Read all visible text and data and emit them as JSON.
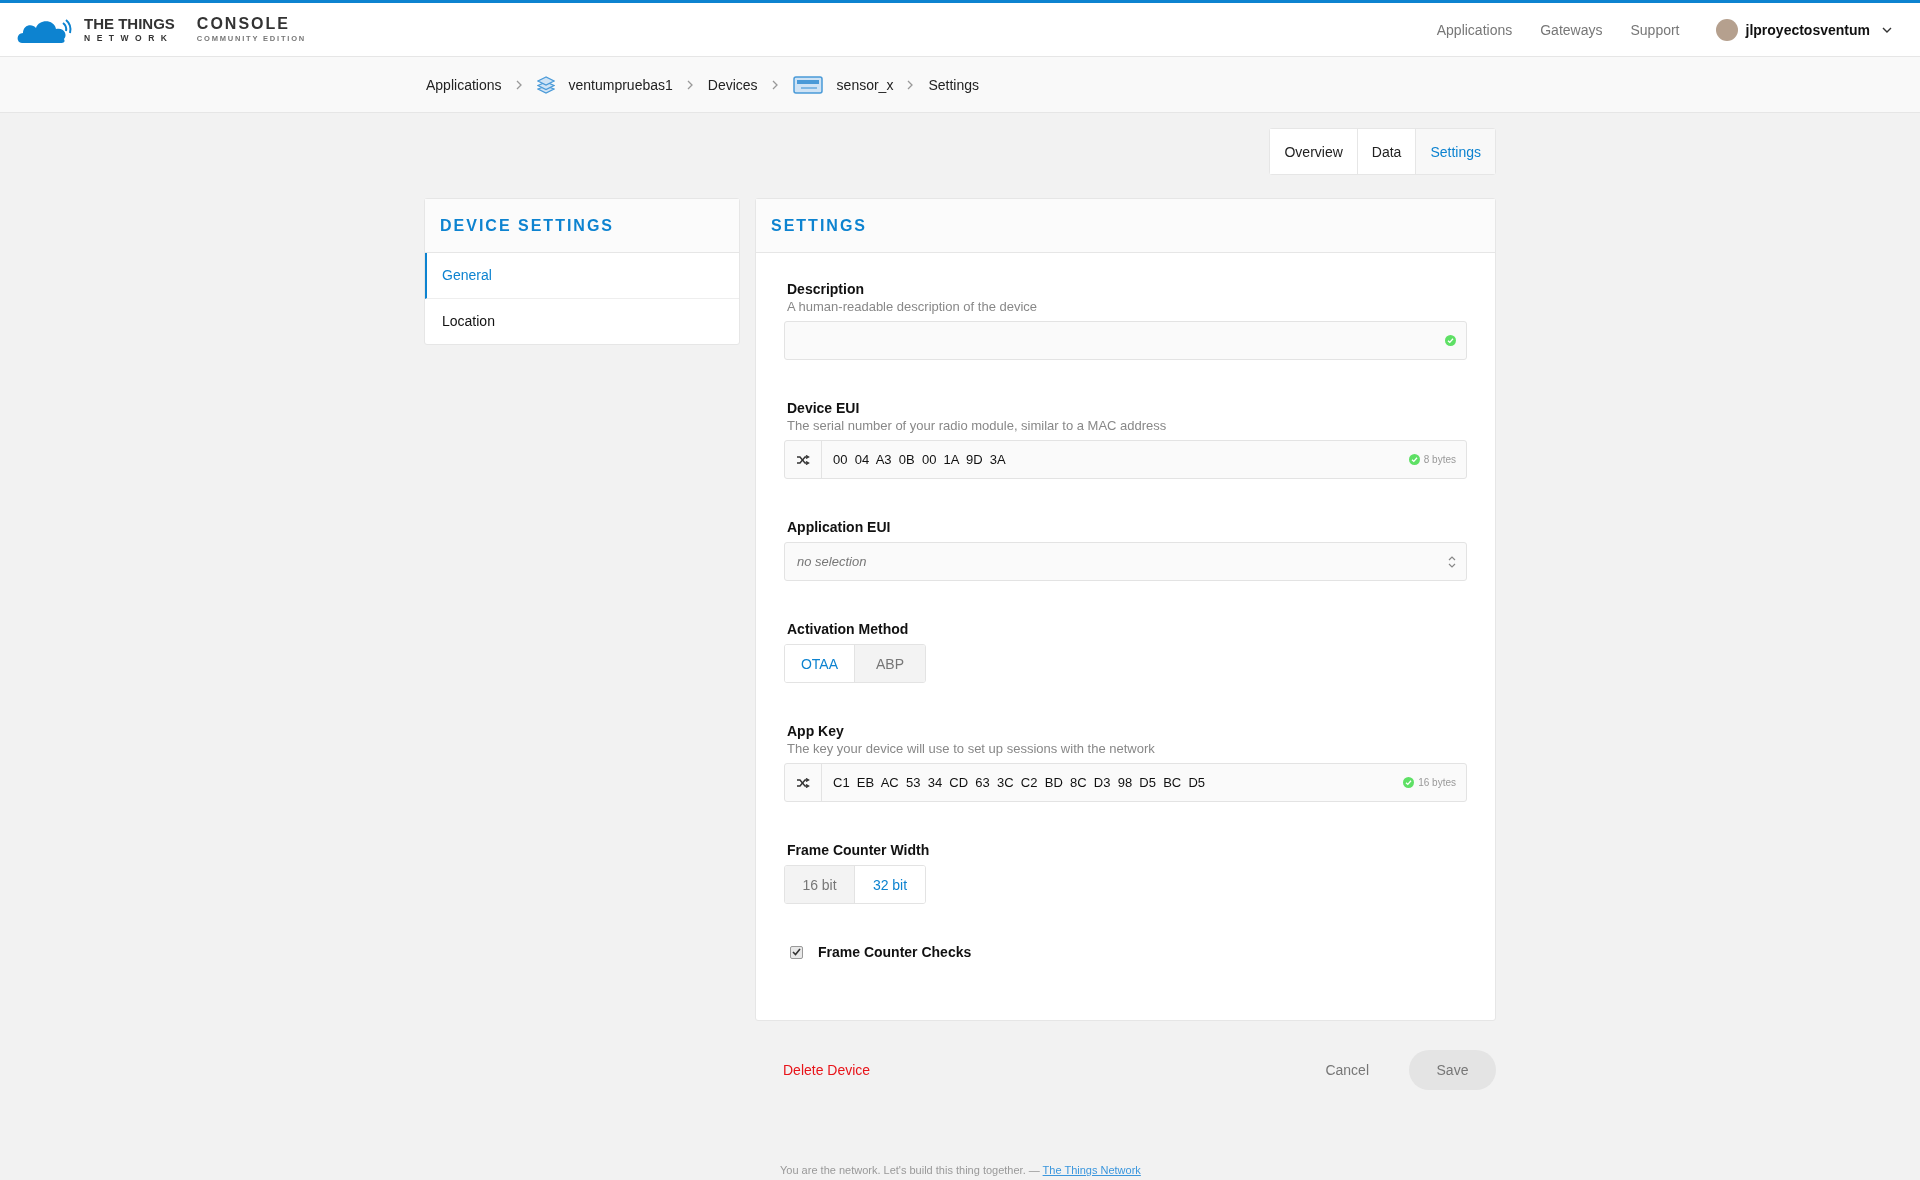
{
  "header": {
    "logo": {
      "line_1": "THE THINGS",
      "line_2": "NETWORK",
      "product": "CONSOLE",
      "edition": "COMMUNITY EDITION"
    },
    "nav": [
      "Applications",
      "Gateways",
      "Support"
    ],
    "user": {
      "name": "jlproyectosventum"
    }
  },
  "breadcrumb": [
    {
      "label": "Applications",
      "kind": "section"
    },
    {
      "label": "ventumpruebas1",
      "kind": "application"
    },
    {
      "label": "Devices",
      "kind": "section"
    },
    {
      "label": "sensor_x",
      "kind": "device"
    },
    {
      "label": "Settings",
      "kind": "section"
    }
  ],
  "tabs": [
    {
      "label": "Overview",
      "selected": false
    },
    {
      "label": "Data",
      "selected": false
    },
    {
      "label": "Settings",
      "selected": true
    }
  ],
  "sidebar": {
    "title": "DEVICE SETTINGS",
    "items": [
      {
        "label": "General",
        "selected": true
      },
      {
        "label": "Location",
        "selected": false
      }
    ]
  },
  "settings": {
    "title": "SETTINGS",
    "fields": [
      {
        "kind": "text",
        "label": "Description",
        "hint": "A human-readable description of the device",
        "valid": true
      },
      {
        "kind": "eui",
        "label": "Device EUI",
        "hint": "The serial number of your radio module, similar to a MAC address",
        "value": "00  04  A3  0B  00  1A  9D  3A",
        "size": "8 bytes",
        "valid": true
      },
      {
        "kind": "select",
        "label": "Application EUI",
        "placeholder": "no selection"
      },
      {
        "kind": "toggle",
        "label": "Activation Method",
        "options": [
          {
            "label": "OTAA",
            "selected": true
          },
          {
            "label": "ABP",
            "selected": false
          }
        ]
      },
      {
        "kind": "eui",
        "label": "App Key",
        "hint": "The key your device will use to set up sessions with the network",
        "value": "C1  EB  AC  53  34  CD  63  3C  C2  BD  8C  D3  98  D5  BC  D5",
        "size": "16 bytes",
        "valid": true
      },
      {
        "kind": "toggle",
        "label": "Frame Counter Width",
        "options": [
          {
            "label": "16 bit",
            "selected": false
          },
          {
            "label": "32 bit",
            "selected": true
          }
        ]
      },
      {
        "kind": "checkbox",
        "label": "Frame Counter Checks",
        "checked": true
      }
    ]
  },
  "actions": {
    "delete": "Delete Device",
    "cancel": "Cancel",
    "save": "Save"
  },
  "footer": {
    "text": "You are the network. Let's build this thing together. —",
    "link": "The Things Network"
  }
}
